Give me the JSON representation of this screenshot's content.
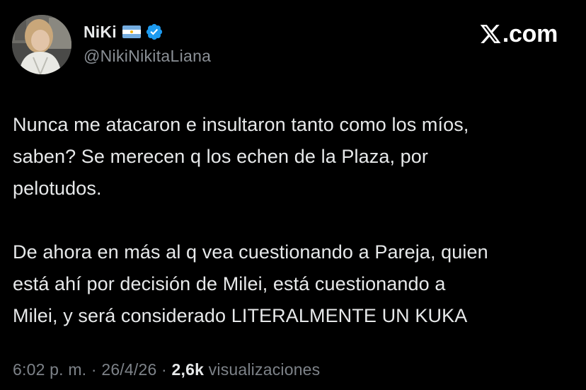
{
  "author": {
    "display_name": "NiKi",
    "handle": "@NikiNikitaLiana",
    "flag_icon": "argentina-flag-icon",
    "verified_icon": "verified-badge-icon"
  },
  "brand": {
    "logo_icon": "x-logo-icon",
    "suffix": ".com"
  },
  "tweet": {
    "paragraphs": [
      "Nunca me atacaron e insultaron tanto como los míos,\nsaben? Se merecen q los echen de la Plaza, por\npelotudos.",
      "De ahora en más al q vea cuestionando a Pareja, quien\nestá ahí por decisión de Milei, está cuestionando a\nMilei, y será considerado LITERALMENTE UN KUKA"
    ]
  },
  "meta": {
    "time": "6:02 p. m.",
    "separator1": " · ",
    "date": "26/4/26",
    "separator2": " · ",
    "views_count": "2,6k",
    "views_label": " visualizaciones"
  },
  "colors": {
    "background": "#000000",
    "primary_text": "#e7e9ea",
    "secondary_text": "#8b9096",
    "verified_blue": "#1d9bf0",
    "flag_blue": "#74acdf",
    "flag_sun": "#f6b40e"
  }
}
